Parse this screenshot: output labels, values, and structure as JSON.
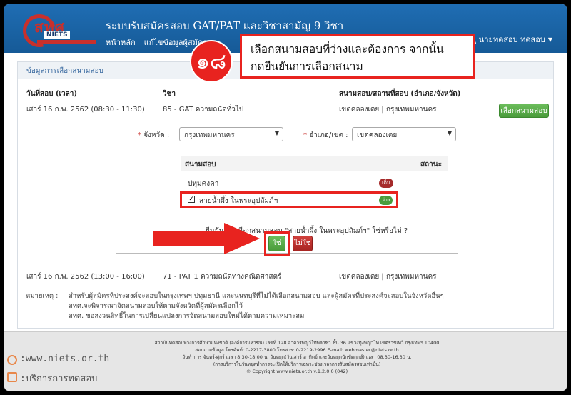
{
  "app": {
    "logo_text": "สทศ",
    "logo_sub": "NIETS",
    "title": "ระบบรับสมัครสอบ GAT/PAT และวิชาสามัญ 9 วิชา",
    "nav": [
      "หน้าหลัก",
      "แก้ไขข้อมูลผู้สมัคร"
    ],
    "user": "นายทดสอบ ทดสอบ"
  },
  "callout": {
    "step": "๑๘",
    "line1": "เลือกสนามสอบที่ว่างและต้องการ จากนั้น",
    "line2": "กดยืนยันการเลือกสนาม"
  },
  "panel": {
    "heading": "ข้อมูลการเลือกสนามสอบ",
    "columns": [
      "วันที่สอบ (เวลา)",
      "วิชา",
      "สนามสอบ/สถานที่สอบ (อำเภอ/จังหวัด)"
    ],
    "rows": [
      {
        "date": "เสาร์ 16 ก.พ. 2562   (08:30 - 11:30)",
        "subject": "85 - GAT ความถนัดทั่วไป",
        "location": "เขตคลองเตย  |  กรุงเทพมหานคร"
      },
      {
        "date": "เสาร์ 16 ก.พ. 2562   (13:00 - 16:00)",
        "subject": "71 - PAT 1 ความถนัดทางคณิตศาสตร์",
        "location": "เขตคลองเตย  |  กรุงเทพมหานคร"
      }
    ],
    "select_button": "เลือกสนามสอบ"
  },
  "picker": {
    "province_label": "จังหวัด",
    "province_value": "กรุงเทพมหานคร",
    "district_label": "อำเภอ/เขต",
    "district_value": "เขตคลองเตย",
    "col_venue": "สนามสอบ",
    "col_status": "สถานะ",
    "venues": [
      {
        "name": "ปทุมคงคา",
        "status": "เต็ม",
        "status_color": "#a52a2a"
      },
      {
        "name": "สายน้ำผึ้ง ในพระอุปถัมภ์ฯ",
        "status": "ว่าง",
        "status_color": "#4a9b3b"
      }
    ],
    "confirm_text": "ยืนยันการเลือกสนามสอบ \"สายน้ำผึ้ง ในพระอุปถัมภ์ฯ\" ใช่หรือไม่ ?",
    "yes": "ใช่",
    "no": "ไม่ใช่"
  },
  "notes": {
    "label": "หมายเหตุ :",
    "lines": [
      "สำหรับผู้สมัครที่ประสงค์จะสอบในกรุงเทพฯ ปทุมธานี และนนทบุรีที่ไม่ได้เลือกสนามสอบ และผู้สมัครที่ประสงค์จะสอบในจังหวัดอื่นๆ",
      "สทศ.จะพิจารณาจัดสนามสอบให้ตามจังหวัดที่ผู้สมัครเลือกไว้",
      "สทศ. ขอสงวนสิทธิ์ในการเปลี่ยนแปลงการจัดสนามสอบใหม่ได้ตามความเหมาะสม"
    ]
  },
  "footer": {
    "lines": [
      "สถาบันทดสอบทางการศึกษาแห่งชาติ (องค์การมหาชน) เลขที่ 128 อาคารพญาไทพลาซ่า ชั้น 36 แขวงทุ่งพญาไท เขตราชเทวี กรุงเทพฯ 10400",
      "สอบถามข้อมูล โทรศัพท์: 0-2217-3800 โทรสาร: 0-2219-2996 E-mail: webmaster@niets.or.th",
      "วันทำการ จันทร์-ศุกร์ เวลา 8:30-18:00 น. วันหยุด(วันเสาร์ อาทิตย์ และวันหยุดนักขัตฤกษ์) เวลา 08.30-16.30 น.",
      "(การบริการในวันหยุดทำการจะเปิดให้บริการเฉพาะช่วงเวลาการรับสมัครสอบเท่านั้น)",
      "© Copyright www.niets.or.th v.1.2.0.0 (042)"
    ],
    "watermark1": ":www.niets.or.th",
    "watermark2": ":บริการการทดสอบ"
  }
}
